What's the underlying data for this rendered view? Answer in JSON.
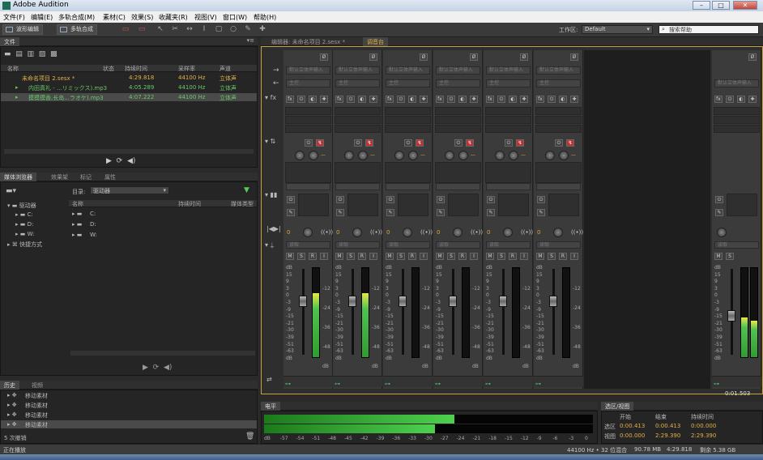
{
  "app": {
    "title": "Adobe Audition",
    "win_min": "–",
    "win_max": "□",
    "win_close": "✕"
  },
  "menu": [
    "文件(F)",
    "编辑(E)",
    "多轨合成(M)",
    "素材(C)",
    "效果(S)",
    "收藏夹(R)",
    "视图(V)",
    "窗口(W)",
    "帮助(H)"
  ],
  "toolbar": {
    "waveform_btn": "波形编辑",
    "multitrack_btn": "多轨合成",
    "workspace_label": "工作区:",
    "workspace_value": "Default",
    "search_placeholder": "搜索帮助"
  },
  "files_panel": {
    "tab": "文件",
    "columns": [
      "名称",
      "状态",
      "持续时间",
      "采样率",
      "声道"
    ],
    "rows": [
      {
        "name": "未命名项目 2.sesx *",
        "status": "",
        "duration": "4:29.818",
        "rate": "44100 Hz",
        "channels": "立体声"
      },
      {
        "name": "内田真礼 - ...リミックス).mp3",
        "status": "",
        "duration": "4:05.289",
        "rate": "44100 Hz",
        "channels": "立体声"
      },
      {
        "name": "摸摸摸香,长岛...ラオケ).mp3",
        "status": "",
        "duration": "4:07.222",
        "rate": "44100 Hz",
        "channels": "立体声"
      }
    ]
  },
  "browser_panel": {
    "tabs": [
      "媒体浏览器",
      "效果架",
      "标记",
      "属性"
    ],
    "dir_label": "目录:",
    "dir_value": "驱动器",
    "tree": [
      "驱动器",
      "C:",
      "D:",
      "W:",
      "快捷方式"
    ],
    "columns": [
      "名称",
      "持续时间",
      "媒体类型"
    ],
    "list": [
      "C:",
      "D:",
      "W:"
    ]
  },
  "history_panel": {
    "tabs": [
      "历史",
      "视频"
    ],
    "items": [
      "移动素材",
      "移动素材",
      "移动素材",
      "移动素材"
    ],
    "undo_count": "5 次撤销"
  },
  "mixer": {
    "tabs": [
      "编辑器: 未命名项目 2.sesx *",
      "调音台"
    ],
    "channels": [
      {
        "name": "轨道 1",
        "send": "S1",
        "vol_left": "0",
        "vol_right": "-3.2",
        "level": 0.72,
        "fader": 0.62
      },
      {
        "name": "轨道 2",
        "send": "S1",
        "vol_left": "-0.3",
        "vol_right": "-3.2",
        "level": 0.72,
        "fader": 0.62
      },
      {
        "name": "轨道 3",
        "send": "S1",
        "vol_left": "0",
        "vol_right": "",
        "level": 0,
        "fader": 0.62
      },
      {
        "name": "轨道 4",
        "send": "S1",
        "vol_left": "0",
        "vol_right": "",
        "level": 0,
        "fader": 0.62
      },
      {
        "name": "轨道 5",
        "send": "S1",
        "vol_left": "0",
        "vol_right": "",
        "level": 0,
        "fader": 0.62
      },
      {
        "name": "轨道 6",
        "send": "S1",
        "vol_left": "0",
        "vol_right": "",
        "level": 0,
        "fader": 0.62
      }
    ],
    "master": {
      "name": "主控",
      "vol_left": "-12.8",
      "vol_right": "-25.3",
      "level": 0.45,
      "fader": 0.45
    },
    "scale_left": [
      "dB",
      "15",
      "9",
      "3",
      "0",
      "-3",
      "-9",
      "-15",
      "-21",
      "-30",
      "-39",
      "-51",
      "-63",
      "dB"
    ],
    "scale_right": [
      "-12",
      "-24",
      "-36",
      "-48",
      "dB"
    ],
    "input_label": "默认立体声输入",
    "output_label": "主控",
    "read_label": "读取",
    "eq_label": "fx",
    "mute": "M",
    "solo": "S",
    "rec": "R",
    "mon": "I"
  },
  "level_panel": {
    "tab": "电平",
    "scale": [
      "dB",
      "-57",
      "-54",
      "-51",
      "-48",
      "-45",
      "-42",
      "-39",
      "-36",
      "-33",
      "-30",
      "-27",
      "-24",
      "-21",
      "-18",
      "-15",
      "-12",
      "-9",
      "-6",
      "-3",
      "0"
    ],
    "top_level": 0.58,
    "bottom_level": 0.52
  },
  "selection_panel": {
    "tab": "选区/视图",
    "headers": [
      "开始",
      "结束",
      "持续时间"
    ],
    "rows": [
      {
        "label": "选区",
        "start": "0:00.413",
        "end": "0:00.413",
        "dur": "0:00.000"
      },
      {
        "label": "视图",
        "start": "0:00.000",
        "end": "2:29.390",
        "dur": "2:29.390"
      }
    ],
    "time": "0:01.503"
  },
  "status": {
    "left": "正在播放",
    "rate": "44100 Hz • 32 位混合",
    "size": "90.78 MB",
    "dur": "4:29.818",
    "free": "剩余 5.38 GB"
  }
}
